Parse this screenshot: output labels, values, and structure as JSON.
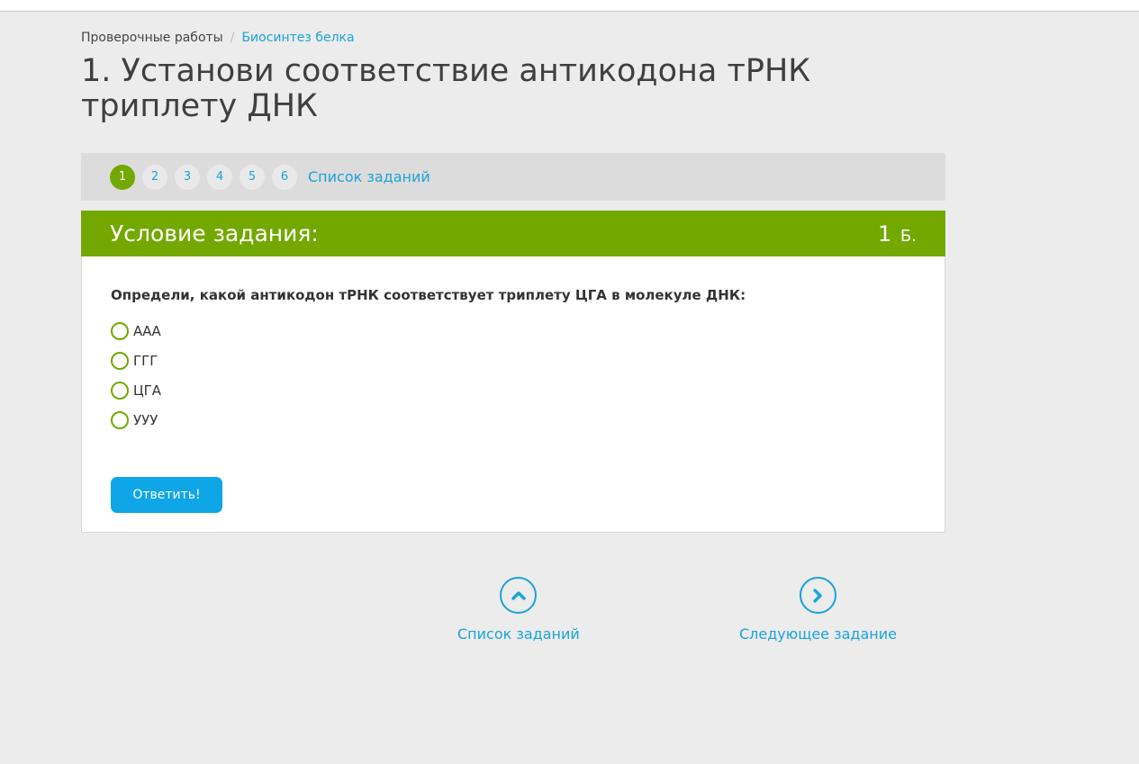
{
  "breadcrumb": {
    "root": "Проверочные работы",
    "separator": "/",
    "current": "Биосинтез белка"
  },
  "title": "1. Установи соответствие антикодона тРНК триплету ДНК",
  "task_nav": {
    "numbers": [
      "1",
      "2",
      "3",
      "4",
      "5",
      "6"
    ],
    "active_index": 0,
    "list_link": "Список заданий"
  },
  "card": {
    "header_title": "Условие задания:",
    "points_value": "1",
    "points_unit": "Б.",
    "question": "Определи, какой антикодон тРНК соответствует триплету ЦГА в молекуле ДНК:",
    "options": [
      "ААА",
      "ГГГ",
      "ЦГА",
      "УУУ"
    ],
    "answer_button": "Ответить!"
  },
  "bottom_nav": {
    "task_list": "Список заданий",
    "next_task": "Следующее задание"
  },
  "icons": {
    "task_list": "chevron-up-circle-icon",
    "next_task": "chevron-right-circle-icon"
  },
  "colors": {
    "accent_green": "#72a800",
    "link_blue": "#1aa3d9",
    "button_blue": "#0fa6e8",
    "background": "#ececec"
  }
}
